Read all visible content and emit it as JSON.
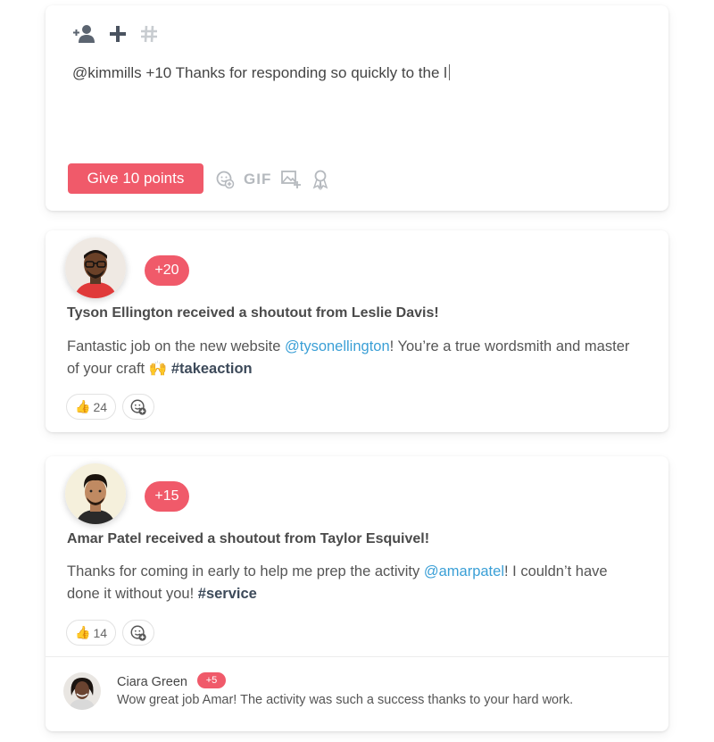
{
  "composer": {
    "icons": [
      "add-person-icon",
      "plus-icon",
      "hashtag-icon"
    ],
    "text": "@kimmills +10 Thanks for responding so quickly to the l",
    "button_label": "Give 10 points",
    "tool_icons": [
      "emoji-add-icon",
      "gif-icon",
      "image-add-icon",
      "award-icon"
    ],
    "gif_label": "GIF"
  },
  "posts": [
    {
      "points": "+20",
      "title": "Tyson Ellington received a shoutout from Leslie Davis!",
      "body_before": "Fantastic job on the new website ",
      "mention": "@tysonellington",
      "body_after": "! You’re a true wordsmith and master of your craft 🙌 ",
      "hashtag": "#takeaction",
      "reaction_emoji": "👍",
      "reaction_count": "24"
    },
    {
      "points": "+15",
      "title": "Amar Patel received a shoutout from Taylor Esquivel!",
      "body_before": "Thanks for coming in early to help me prep the activity ",
      "mention": "@amarpatel",
      "body_after": "! I couldn’t have done it without you! ",
      "hashtag": "#service",
      "reaction_emoji": "👍",
      "reaction_count": "14",
      "comment": {
        "name": "Ciara Green",
        "points": "+5",
        "text": "Wow great job Amar! The activity was such a success thanks to your hard work."
      }
    }
  ],
  "colors": {
    "accent": "#f05a6a",
    "mention": "#3a9fd6",
    "hashtag": "#3d4a5a"
  }
}
